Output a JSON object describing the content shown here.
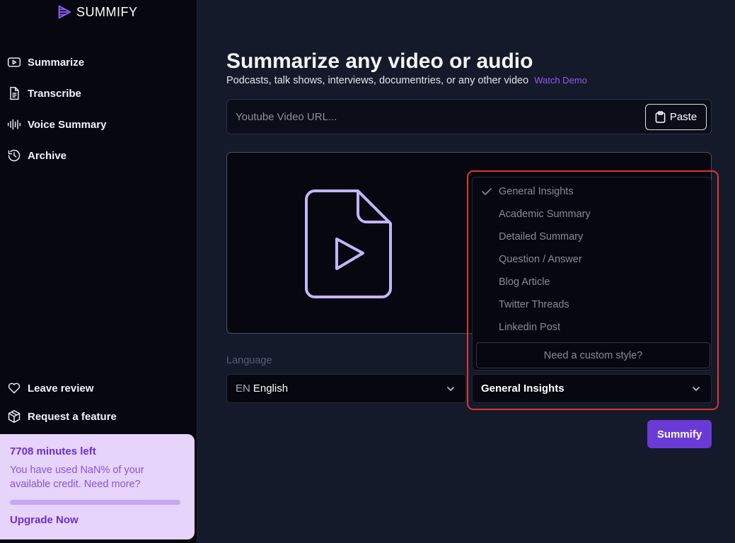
{
  "brand": {
    "name": "SUMMIFY",
    "accent": "#8c5cf0"
  },
  "sidebar": {
    "items": [
      {
        "label": "Summarize",
        "icon": "play-rectangle-icon"
      },
      {
        "label": "Transcribe",
        "icon": "document-icon"
      },
      {
        "label": "Voice Summary",
        "icon": "waveform-icon"
      },
      {
        "label": "Archive",
        "icon": "history-icon"
      }
    ],
    "bottom_items": [
      {
        "label": "Leave review",
        "icon": "heart-icon"
      },
      {
        "label": "Request a feature",
        "icon": "package-icon"
      }
    ],
    "credit": {
      "minutes_left": "7708 minutes left",
      "usage_text": "You have used NaN% of your available credit. Need more?",
      "progress_fraction": 1.0,
      "upgrade_label": "Upgrade Now"
    }
  },
  "main": {
    "title": "Summarize any video or audio",
    "subtitle": "Podcasts, talk shows, interviews, documentries, or any other video",
    "watch_demo": "Watch Demo",
    "url_placeholder": "Youtube Video URL...",
    "paste_label": "Paste",
    "language_label": "Language",
    "language_code": "EN",
    "language_value": "English",
    "style_value": "General Insights",
    "summify_label": "Summify"
  },
  "style_dropdown": {
    "options": [
      {
        "label": "General Insights",
        "selected": true
      },
      {
        "label": "Academic Summary",
        "selected": false
      },
      {
        "label": "Detailed Summary",
        "selected": false
      },
      {
        "label": "Question / Answer",
        "selected": false
      },
      {
        "label": "Blog Article",
        "selected": false
      },
      {
        "label": "Twitter Threads",
        "selected": false
      },
      {
        "label": "Linkedin Post",
        "selected": false
      }
    ],
    "custom_label": "Need a custom style?"
  }
}
